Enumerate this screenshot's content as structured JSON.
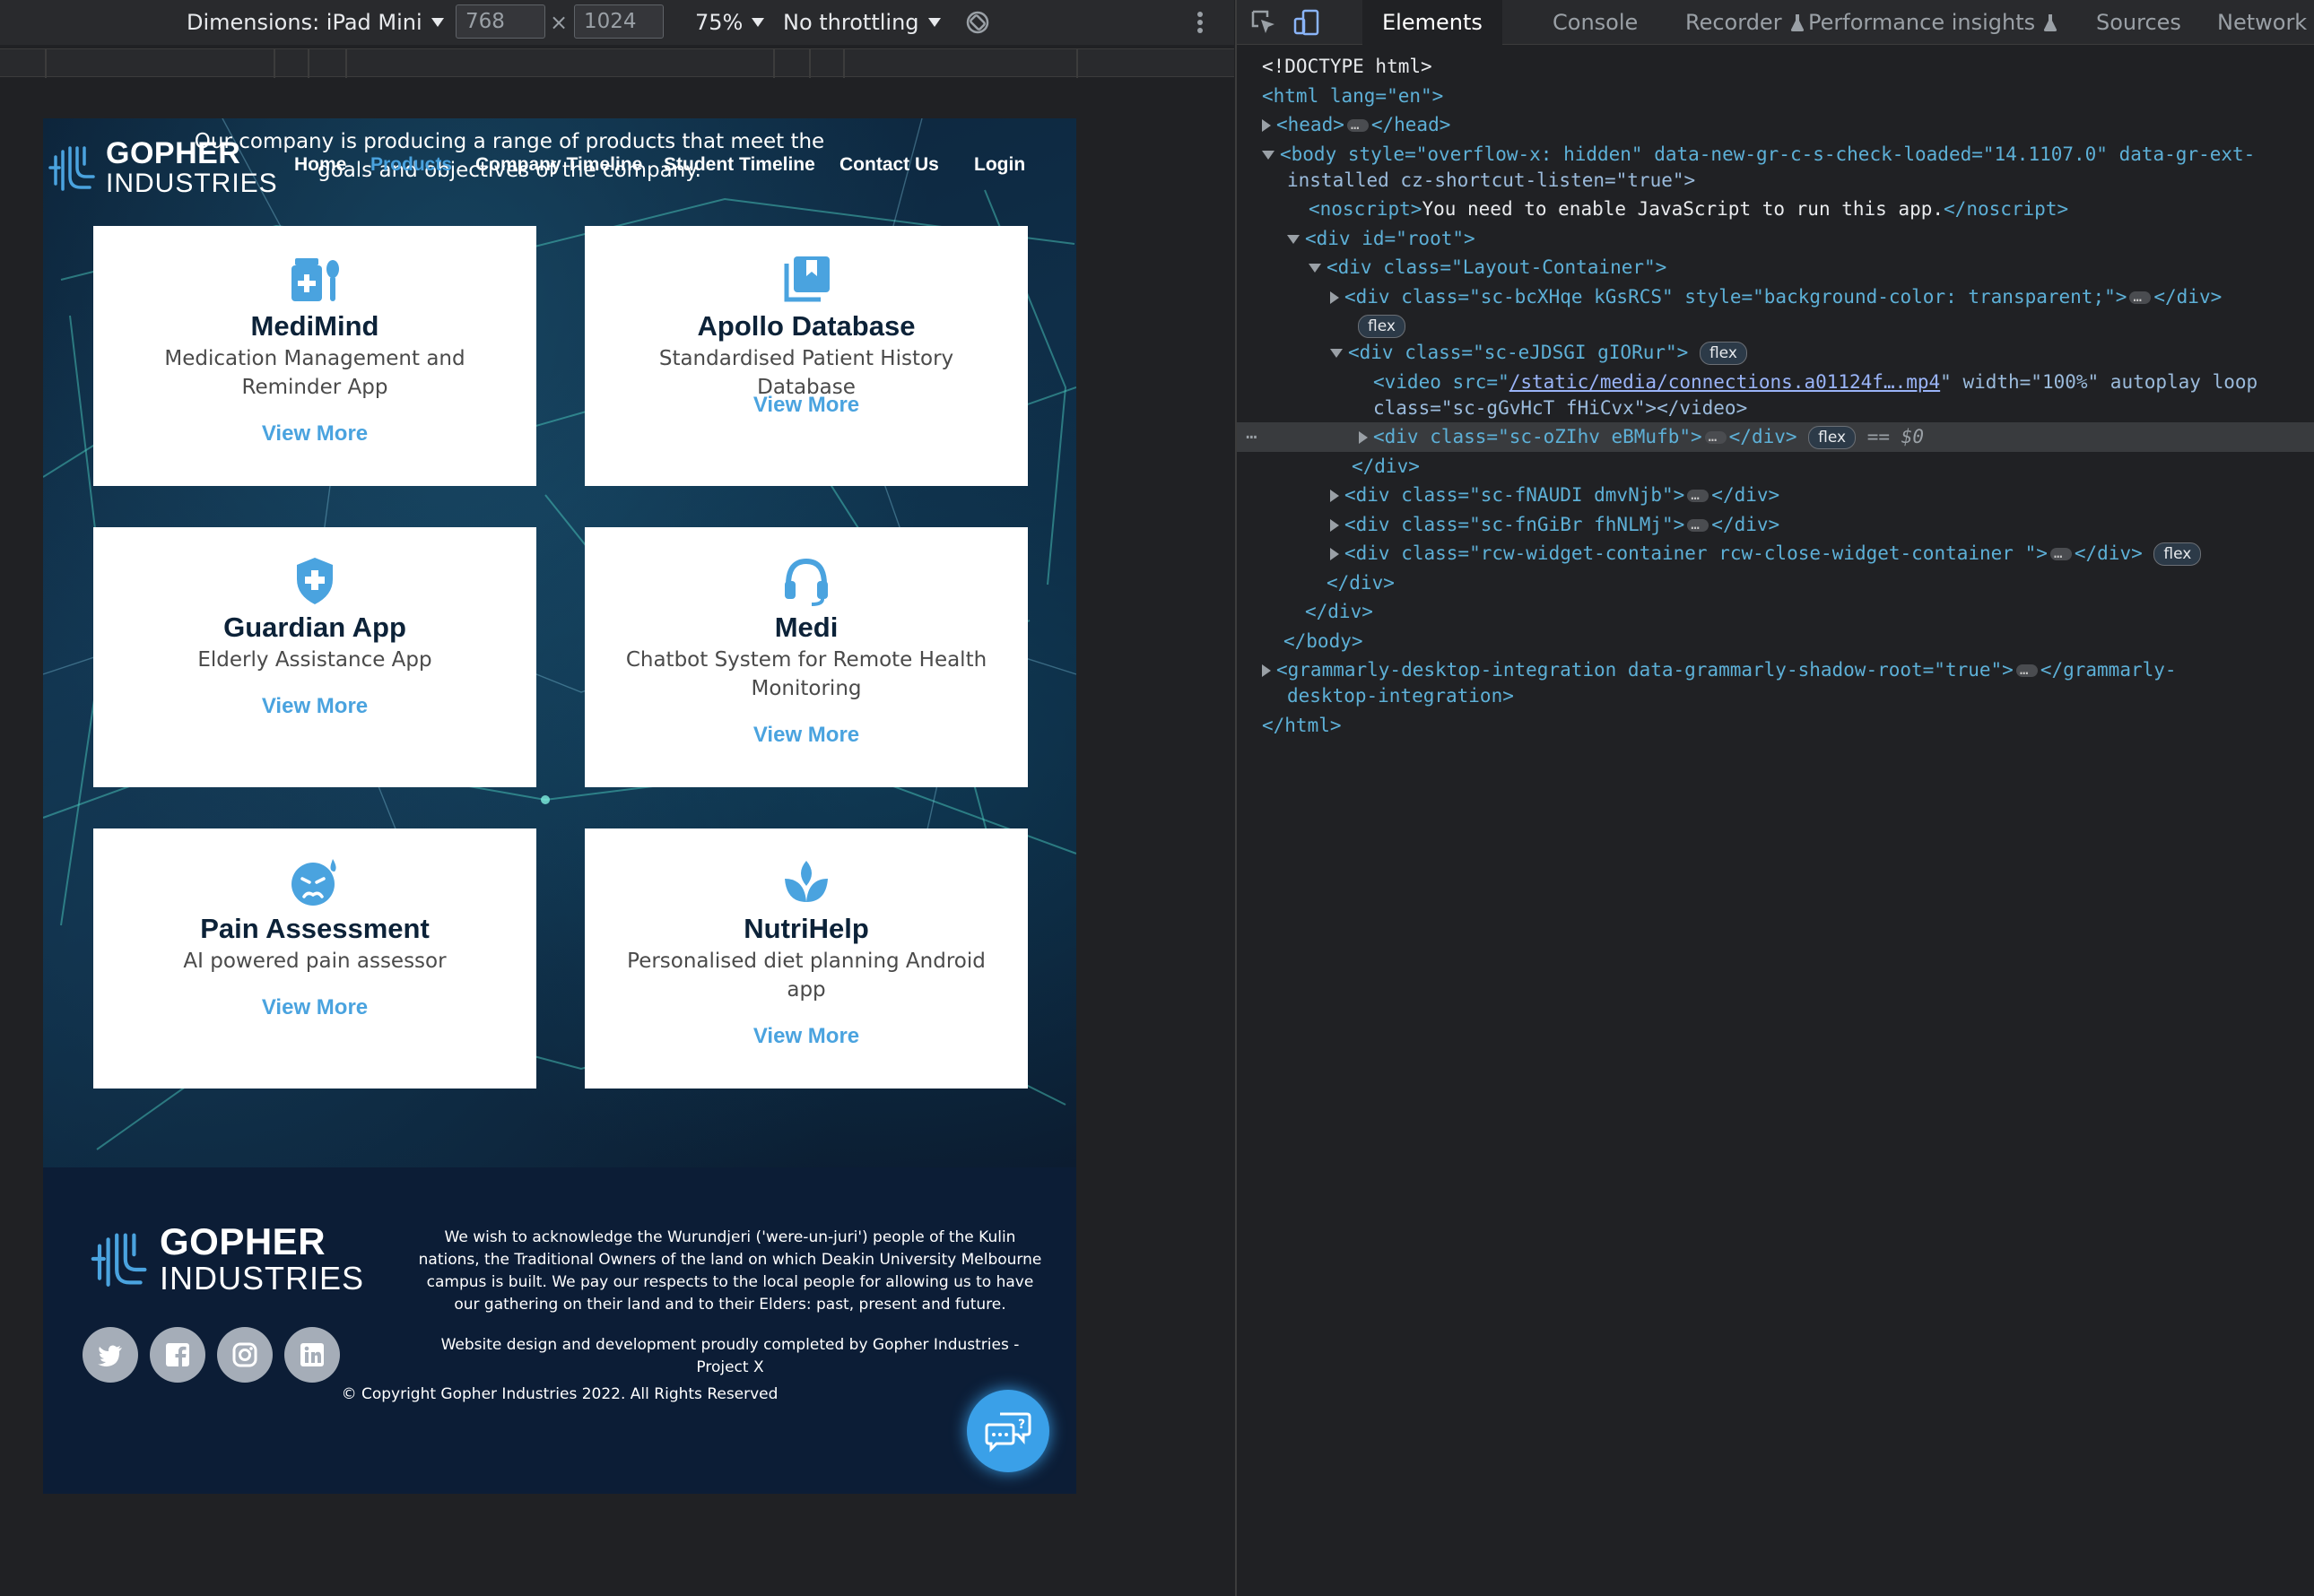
{
  "device_toolbar": {
    "dimensions_label": "Dimensions: iPad Mini",
    "width_value": "768",
    "times": "×",
    "height_value": "1024",
    "zoom": "75%",
    "throttling": "No throttling"
  },
  "site": {
    "intro": "Our company is producing a range of products that meet the goals and objectives of the company.",
    "brand_line1": "GOPHER",
    "brand_line2": "INDUSTRIES",
    "nav": [
      {
        "label": "Home"
      },
      {
        "label": "Products"
      },
      {
        "label": "Company Timeline"
      },
      {
        "label": "Student Timeline"
      },
      {
        "label": "Contact Us"
      },
      {
        "label": "Login"
      }
    ],
    "cards": [
      {
        "title": "MediMind",
        "subtitle": "Medication Management and Reminder App",
        "more": "View More",
        "icon": "medicine-icon"
      },
      {
        "title": "Apollo Database",
        "subtitle": "Standardised Patient History Database",
        "more": "View More",
        "icon": "library-icon"
      },
      {
        "title": "Guardian App",
        "subtitle": "Elderly Assistance App",
        "more": "View More",
        "icon": "shield-plus-icon"
      },
      {
        "title": "Medi",
        "subtitle": "Chatbot System for Remote Health Monitoring",
        "more": "View More",
        "icon": "headset-icon"
      },
      {
        "title": "Pain Assessment",
        "subtitle": "AI powered pain assessor",
        "more": "View More",
        "icon": "pain-face-icon"
      },
      {
        "title": "NutriHelp",
        "subtitle": "Personalised diet planning Android app",
        "more": "View More",
        "icon": "spa-icon"
      }
    ],
    "footer": {
      "acknowledgement": "We wish to acknowledge the Wurundjeri ('were-un-juri') people of the Kulin nations, the Traditional Owners of the land on which Deakin University Melbourne campus is built. We pay our respects to the local people for allowing us to have our gathering on their land and to their Elders: past, present and future.",
      "credit": "Website design and development proudly completed by Gopher Industries - Project X",
      "copyright": "© Copyright Gopher Industries 2022. All Rights Reserved",
      "social": [
        "twitter-icon",
        "facebook-icon",
        "instagram-icon",
        "linkedin-icon"
      ]
    },
    "colors": {
      "accent": "#4aa3df",
      "footer_bg": "#0c1d36",
      "title": "#0c2238"
    }
  },
  "devtools": {
    "tabs": [
      "Elements",
      "Console",
      "Recorder",
      "Performance insights",
      "Sources",
      "Network"
    ],
    "dom": {
      "doctype": "<!DOCTYPE html>",
      "html_open": "<html lang=\"en\">",
      "head": "<head>",
      "head_close": "</head>",
      "body_attrs_1": "<body style=\"overflow-x: hidden\" data-new-gr-c-s-check-loaded=\"14.1107.0\" data-gr-ext-",
      "body_attrs_2": "installed cz-shortcut-listen=\"true\">",
      "noscript": "You need to enable JavaScript to run this app.",
      "root": "<div id=\"root\">",
      "layout": "<div class=\"Layout-Container\">",
      "div1": "<div class=\"sc-bcXHqe kGsRCS\" style=\"background-color: transparent;\">",
      "flex": "flex",
      "div2": "<div class=\"sc-eJDSGI gIORur\">",
      "video_1": "<video src=\"",
      "video_src": "/static/media/connections.a01124f….mp4",
      "video_2": "\" width=\"100%\" autoplay loop",
      "video_3": "class=\"sc-gGvHcT fHiCvx\"></video>",
      "div3": "<div class=\"sc-oZIhv eBMufb\">",
      "eq0": "== $0",
      "div_close": "</div>",
      "div4": "<div class=\"sc-fNAUDI dmvNjb\">",
      "div5": "<div class=\"sc-fnGiBr fhNLMj\">",
      "div6": "<div class=\"rcw-widget-container rcw-close-widget-container \">",
      "body_close": "</body>",
      "gram_1": "<grammarly-desktop-integration data-grammarly-shadow-root=\"true\">",
      "gram_2": "</grammarly-",
      "gram_3": "desktop-integration>",
      "html_close": "</html>"
    }
  }
}
